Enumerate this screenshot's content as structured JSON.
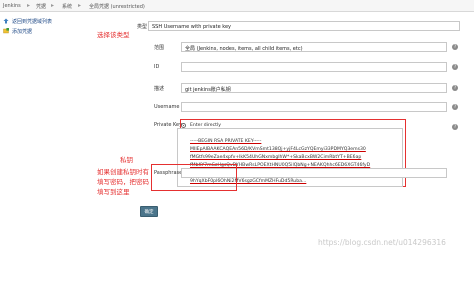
{
  "breadcrumb": {
    "items": [
      "Jenkins",
      "凭据",
      "系统",
      "全局凭据 (unrestricted)"
    ],
    "separator": "▸"
  },
  "sidebar": {
    "items": [
      {
        "label": "返回到凭据域列表",
        "icon": "arrow-up-icon"
      },
      {
        "label": "添加凭据",
        "icon": "add-credential-icon"
      }
    ]
  },
  "form": {
    "kind": {
      "label": "类型",
      "value": "SSH Username with private key"
    },
    "scope": {
      "label": "范围",
      "value": "全局 (Jenkins, nodes, items, all child items, etc)"
    },
    "id": {
      "label": "ID",
      "value": ""
    },
    "description": {
      "label": "描述",
      "value": "git jenkins账户私钥"
    },
    "username": {
      "label": "Username",
      "value": ""
    },
    "private_key": {
      "label": "Private Key",
      "enter_directly_label": "Enter directly",
      "key_label": "Key",
      "lines": [
        "-----BEGIN RSA PRIVATE KEY-----",
        "MIIEpAIBAAKCAQEAn56D/KVmSmt138Qj+yjF4LcGzYQEmyi33PDMYQ3ems30",
        "fMGtfs99eZae4xpfv+lkK54UhGNxmbglhW*+SkaBcxBW2CimRbtYT+BE6ap",
        "fMbKY7mGzHgsQvDYHBwRsLPOEXtHNU0Q5ilQbNg+NEAKQhhc6ED6XGT46fyD",
        "f++LYgr53zB9Xzv67FWbT00fLY6HPexfNYgC2w2usL4dxLCKzNER50XMhWqtnO3",
        "9hYqXbF0pl6OhNi2MV6sgzGCfmMZHFuDd5Ruba..."
      ]
    },
    "passphrase": {
      "label": "Passphrase",
      "value": ""
    },
    "ok_label": "确定"
  },
  "annotations": {
    "select_type": "选择该类型",
    "private_key": "私钥",
    "passphrase_note_lines": [
      "如果创建私钥时有",
      "填写密码，把密码",
      "填写到这里"
    ]
  },
  "watermark": "https://blog.csdn.net/u014296316",
  "colors": {
    "annotation": "#e53030",
    "button": "#4b758b",
    "link": "#204a87"
  }
}
